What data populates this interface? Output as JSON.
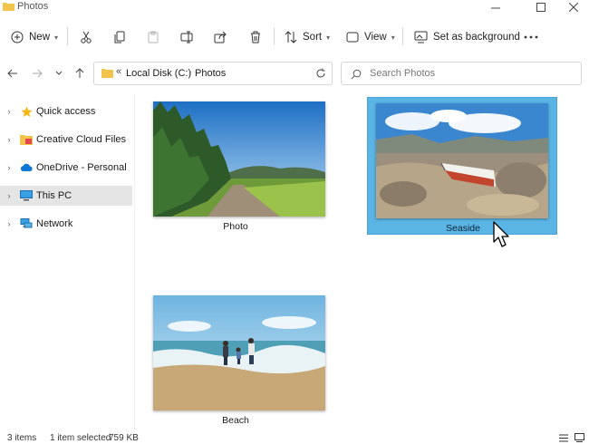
{
  "window": {
    "title": "Photos"
  },
  "toolbar": {
    "new_label": "New",
    "sort_label": "Sort",
    "view_label": "View",
    "set_background_label": "Set as background"
  },
  "address": {
    "crumbs": [
      "Local Disk (C:)",
      "Photos"
    ],
    "search_placeholder": "Search Photos"
  },
  "sidebar": {
    "items": [
      {
        "label": "Quick access",
        "icon": "star-icon"
      },
      {
        "label": "Creative Cloud Files",
        "icon": "creative-cloud-icon"
      },
      {
        "label": "OneDrive - Personal",
        "icon": "cloud-icon"
      },
      {
        "label": "This PC",
        "icon": "computer-icon",
        "selected": true
      },
      {
        "label": "Network",
        "icon": "network-icon"
      }
    ]
  },
  "files": [
    {
      "name": "Photo",
      "selected": false
    },
    {
      "name": "Seaside",
      "selected": true
    },
    {
      "name": "Beach",
      "selected": false
    }
  ],
  "status": {
    "item_count": "3 items",
    "selection": "1 item selected",
    "size": "759 KB"
  },
  "colors": {
    "selection": "#5ab4e4",
    "sidebar_selected": "#e5e5e5",
    "folder": "#f2c44b"
  }
}
